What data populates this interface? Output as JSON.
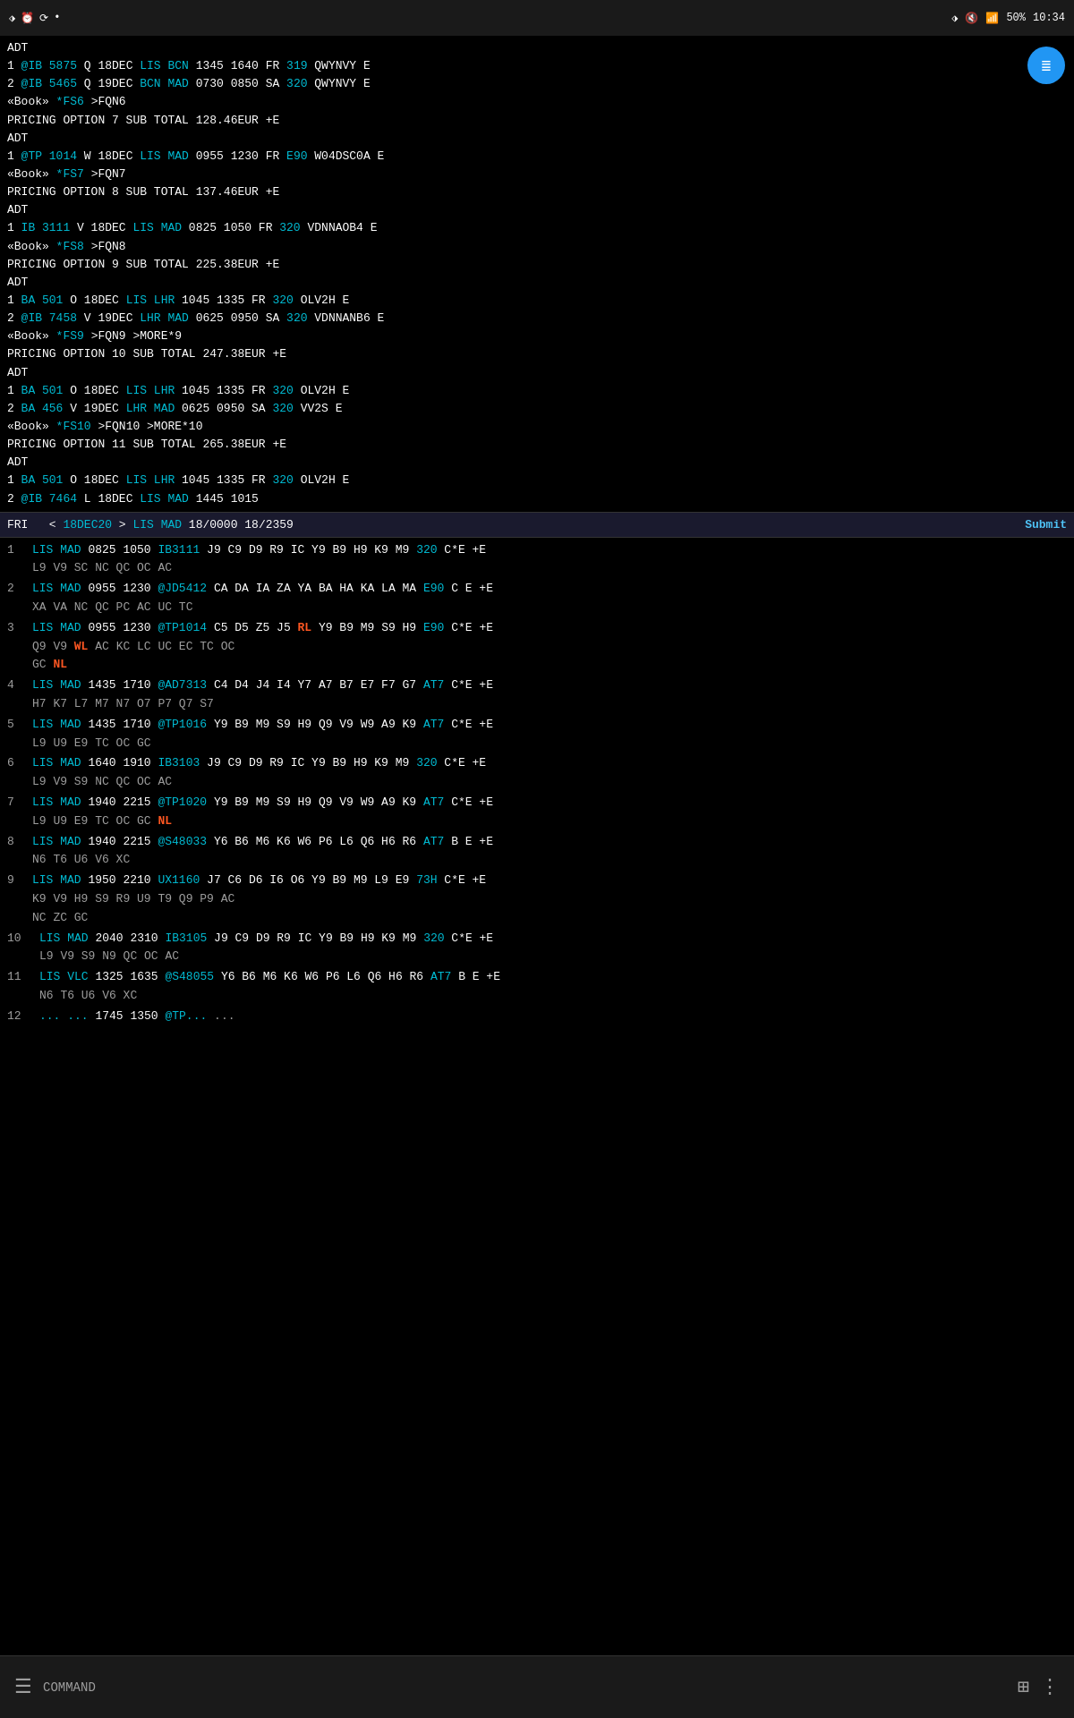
{
  "statusBar": {
    "leftIcons": [
      "bluetooth",
      "alarm",
      "sync",
      "dot"
    ],
    "battery": "50%",
    "time": "10:34",
    "rightIcons": [
      "bluetooth",
      "mute",
      "wifi",
      "battery"
    ]
  },
  "fab": {
    "icon": "≡",
    "label": "filter-button"
  },
  "topSection": {
    "lines": [
      "ADT",
      "1  @IB 5875   Q   18DEC  LIS BCN   1345   1640   FR   319   QWYNVY     E",
      "2  @IB 5465   Q   19DEC  BCN MAD   0730   0850   SA   320   QWYNVY     E",
      "«Book»    *FS6          >FQN6",
      "PRICING OPTION 7                        SUB TOTAL   128.46EUR +E",
      "ADT",
      "1 @TP 1014   W   18DEC  LIS MAD   0955   1230   FR   E90   W04DSC0A   E",
      "«Book»    *FS7          >FQN7",
      "PRICING OPTION 8                        SUB TOTAL   137.46EUR +E",
      "ADT",
      "1  IB 3111   V   18DEC  LIS MAD   0825   1050   FR   320   VDNNAOB4   E",
      "«Book»    *FS8          >FQN8",
      "PRICING OPTION 9                        SUB TOTAL   225.38EUR +E",
      "ADT",
      "1  BA  501   O   18DEC  LIS LHR   1045   1335   FR   320   OLV2H      E",
      "2 @IB 7458   V   19DEC  LHR MAD   0625   0950   SA   320   VDNNANB6   E",
      "«Book»    *FS9          >FQN9                              >MORE*9",
      "PRICING OPTION 10                       SUB TOTAL   247.38EUR +E",
      "ADT",
      "1  BA  501   O   18DEC  LIS LHR   1045   1335   FR   320   OLV2H      E",
      "2  BA  456   V   19DEC  LHR MAD   0625   0950   SA   320   VV2S       E",
      "«Book»    *FS10         >FQN10                            >MORE*10",
      "PRICING OPTION 11                       SUB TOTAL   265.38EUR +E",
      "ADT",
      "1  BA  501   O   18DEC  LIS LHR   1045   1335   FR   320   OLV2H      E",
      "2  @IB 7464  L   18DEC  LIS MAD   1445   1015"
    ]
  },
  "dividerBar": {
    "left": "FRI   < 18DEC20 >  LIS    MAD    18/0000  18/2359",
    "right": "Submit"
  },
  "availSection": {
    "rows": [
      {
        "num": "1",
        "origin": "LIS",
        "dest": "MAD",
        "dep": "0825",
        "arr": "1050",
        "flight": "IB3111",
        "classes1": "J9 C9 D9 R9 IC Y9 B9 H9 K9 M9 320 C*E +E",
        "classes2": "L9 V9 SC NC QC OC AC"
      },
      {
        "num": "2",
        "origin": "LIS",
        "dest": "MAD",
        "dep": "0955",
        "arr": "1230",
        "flight": "@JD5412",
        "classes1": "CA DA IA ZA YA BA HA KA LA MA E90 C E +E",
        "classes2": "XA VA NC QC PC AC UC TC"
      },
      {
        "num": "3",
        "origin": "LIS",
        "dest": "MAD",
        "dep": "0955",
        "arr": "1230",
        "flight": "@TP1014",
        "classes1": "C5 D5 Z5 J5 RL Y9 B9 M9 S9 H9 E90 C*E +E",
        "classes2": "Q9 V9 WL AC KC LC UC EC TC OC",
        "classes3": "GC NL"
      },
      {
        "num": "4",
        "origin": "LIS",
        "dest": "MAD",
        "dep": "1435",
        "arr": "1710",
        "flight": "@AD7313",
        "classes1": "C4 D4 J4 I4 Y7 A7 B7 E7 F7 G7 AT7 C*E +E",
        "classes2": "H7 K7 L7 M7 N7 O7 P7 Q7 S7"
      },
      {
        "num": "5",
        "origin": "LIS",
        "dest": "MAD",
        "dep": "1435",
        "arr": "1710",
        "flight": "@TP1016",
        "classes1": "Y9 B9 M9 S9 H9 Q9 V9 W9 A9 K9 AT7 C*E +E",
        "classes2": "L9 U9 E9 TC OC GC"
      },
      {
        "num": "6",
        "origin": "LIS",
        "dest": "MAD",
        "dep": "1640",
        "arr": "1910",
        "flight": "IB3103",
        "classes1": "J9 C9 D9 R9 IC Y9 B9 H9 K9 M9 320 C*E +E",
        "classes2": "L9 V9 S9 NC QC OC AC"
      },
      {
        "num": "7",
        "origin": "LIS",
        "dest": "MAD",
        "dep": "1940",
        "arr": "2215",
        "flight": "@TP1020",
        "classes1": "Y9 B9 M9 S9 H9 Q9 V9 W9 A9 K9 AT7 C*E +E",
        "classes2": "L9 U9 E9 TC OC GC NL"
      },
      {
        "num": "8",
        "origin": "LIS",
        "dest": "MAD",
        "dep": "1940",
        "arr": "2215",
        "flight": "@S48033",
        "classes1": "Y6 B6 M6 K6 W6 P6 L6 Q6 H6 R6 AT7 B E +E",
        "classes2": "N6 T6 U6 V6 XC"
      },
      {
        "num": "9",
        "origin": "LIS",
        "dest": "MAD",
        "dep": "1950",
        "arr": "2210",
        "flight": "UX1160",
        "classes1": "J7 C6 D6 I6 O6 Y9 B9 M9 L9 E9 73H C*E +E",
        "classes2": "K9 V9 H9 S9 R9 U9 T9 Q9 P9 AC",
        "classes3": "NC ZC GC"
      },
      {
        "num": "10",
        "origin": "LIS",
        "dest": "MAD",
        "dep": "2040",
        "arr": "2310",
        "flight": "IB3105",
        "classes1": "J9 C9 D9 R9 IC Y9 B9 H9 K9 M9 320 C*E +E",
        "classes2": "L9 V9 S9 N9 QC OC AC"
      },
      {
        "num": "11",
        "origin": "LIS",
        "dest": "VLC",
        "dep": "1325",
        "arr": "1635",
        "flight": "@S48055",
        "classes1": "Y6 B6 M6 K6 W6 P6 L6 Q6 H6 R6 AT7 B E +E",
        "classes2": "N6 T6 U6 V6 XC"
      },
      {
        "num": "12",
        "origin": "...",
        "dest": "...",
        "dep": "1745",
        "arr": "1350",
        "flight": "@TP...",
        "classes1": "...",
        "classes2": "..."
      }
    ]
  },
  "bottomBar": {
    "menuIcon": "☰",
    "commandLabel": "COMMAND",
    "gridIcon": "⊞",
    "dotsIcon": "⋮"
  }
}
